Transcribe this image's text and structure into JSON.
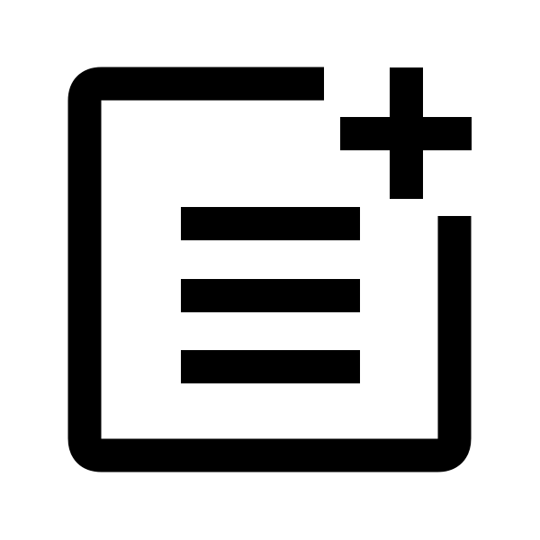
{
  "icon": {
    "name": "add-note-icon",
    "foreground_color": "#000000",
    "background_color": "#ffffff",
    "line_count": 3
  }
}
